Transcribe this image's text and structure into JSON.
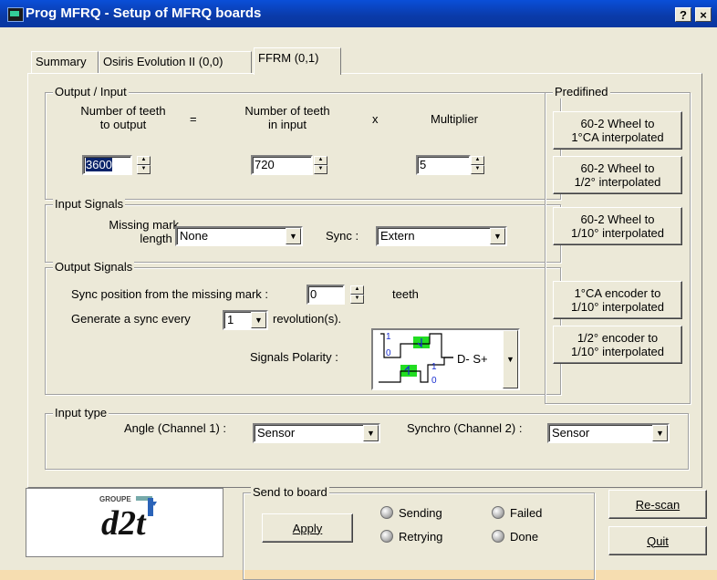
{
  "window": {
    "title": "Prog MFRQ - Setup of MFRQ boards",
    "help_btn": "?",
    "close_btn": "×"
  },
  "tabs": [
    {
      "label": "Summary"
    },
    {
      "label": "Osiris Evolution II (0,0)"
    },
    {
      "label": "FFRM (0,1)"
    }
  ],
  "output_input": {
    "legend": "Output / Input",
    "col1": "Number of teeth\nto output",
    "eq": "=",
    "col2": "Number of teeth\nin input",
    "times": "x",
    "col3": "Multiplier",
    "teeth_output_value": "3600",
    "teeth_input_value": "720",
    "multiplier_value": "5"
  },
  "input_signals": {
    "legend": "Input Signals",
    "missing_mark_label": "Missing mark\nlength :",
    "missing_mark_value": "None",
    "sync_label": "Sync :",
    "sync_value": "Extern"
  },
  "output_signals": {
    "legend": "Output Signals",
    "sync_pos_label": "Sync position from the missing mark :",
    "sync_pos_value": "0",
    "teeth_label": "teeth",
    "gen_sync_label": "Generate a sync every",
    "gen_sync_value": "1",
    "revolutions_label": "revolution(s).",
    "polarity_label": "Signals Polarity :",
    "polarity_value": "D- S+",
    "polarity_marks": {
      "one_a": "1",
      "zero_a": "0",
      "one_b": "1",
      "zero_b": "0"
    }
  },
  "predefined": {
    "legend": "Predifined",
    "buttons": [
      {
        "label": "60-2 Wheel to\n1°CA interpolated"
      },
      {
        "label": "60-2 Wheel to\n1/2° interpolated"
      },
      {
        "label": "60-2 Wheel to\n1/10° interpolated"
      },
      {
        "label": "1°CA encoder to\n1/10° interpolated"
      },
      {
        "label": "1/2° encoder to\n1/10° interpolated"
      }
    ]
  },
  "input_type": {
    "legend": "Input type",
    "angle_label": "Angle (Channel 1) :",
    "angle_value": "Sensor",
    "synchro_label": "Synchro (Channel 2) :",
    "synchro_value": "Sensor"
  },
  "logo": {
    "groupe": "GROUPE",
    "mark": "d2t"
  },
  "send": {
    "legend": "Send to board",
    "apply": "Apply",
    "status": {
      "sending": "Sending",
      "retrying": "Retrying",
      "failed": "Failed",
      "done": "Done"
    }
  },
  "rescan": "Re-scan",
  "quit": "Quit",
  "colors": {
    "titlebar": "#0a3aa8",
    "face": "#ece9d8",
    "polarity_green": "#22dd22",
    "polarity_blue": "#1a2fd0"
  }
}
